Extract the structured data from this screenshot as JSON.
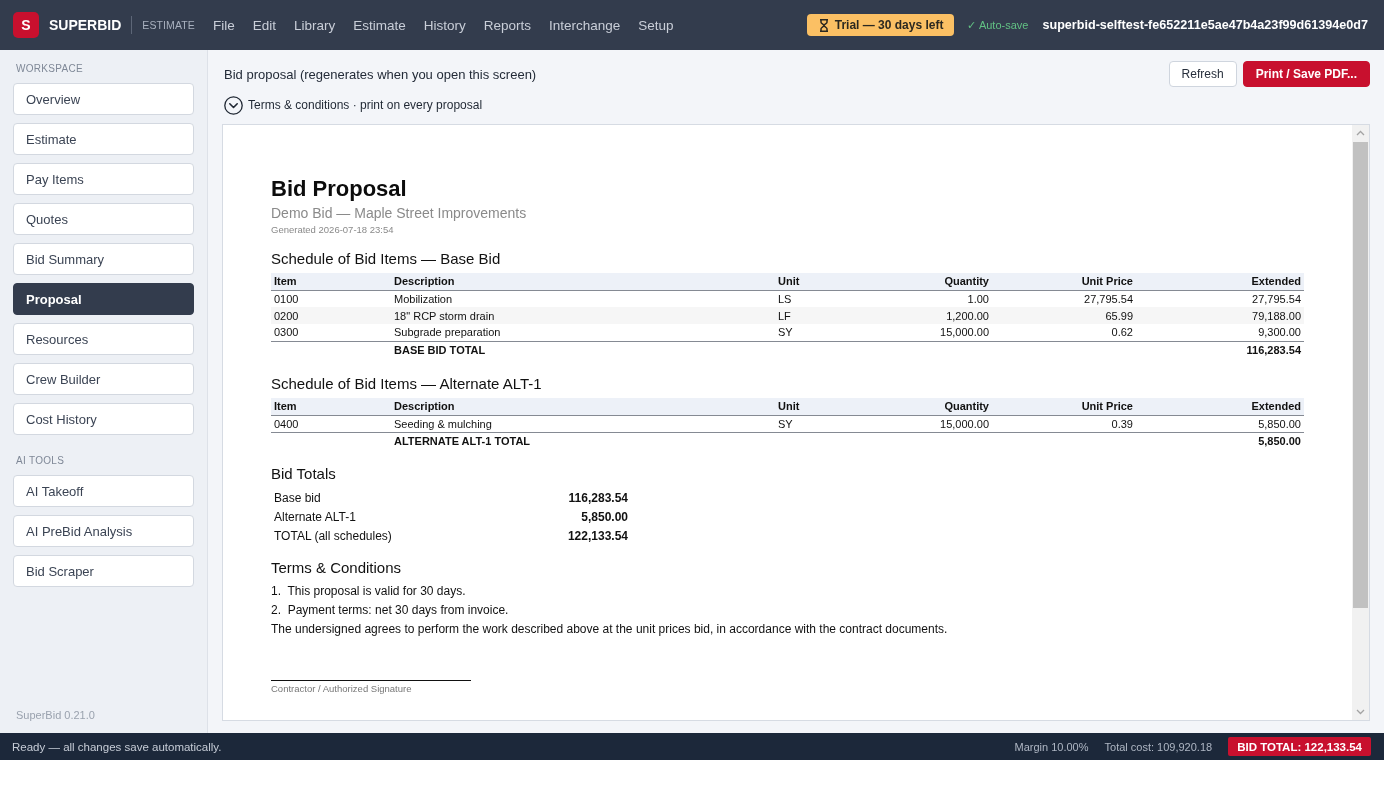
{
  "app_bar": {
    "logo_letter": "S",
    "brand": "SUPERBID",
    "module": "ESTIMATE",
    "menu": [
      "File",
      "Edit",
      "Library",
      "Estimate",
      "History",
      "Reports",
      "Interchange",
      "Setup"
    ],
    "trial_badge": "Trial — 30 days left",
    "autosave": "✓ Auto-save",
    "project": "superbid-selftest-fe652211e5ae47b4a23f99d61394e0d7"
  },
  "sidebar": {
    "sections": [
      {
        "title": "WORKSPACE",
        "items": [
          {
            "label": "Overview",
            "selected": false
          },
          {
            "label": "Estimate",
            "selected": false
          },
          {
            "label": "Pay Items",
            "selected": false
          },
          {
            "label": "Quotes",
            "selected": false
          },
          {
            "label": "Bid Summary",
            "selected": false
          },
          {
            "label": "Proposal",
            "selected": true
          },
          {
            "label": "Resources",
            "selected": false
          },
          {
            "label": "Crew Builder",
            "selected": false
          },
          {
            "label": "Cost History",
            "selected": false
          }
        ]
      },
      {
        "title": "AI TOOLS",
        "items": [
          {
            "label": "AI Takeoff",
            "selected": false
          },
          {
            "label": "AI PreBid Analysis",
            "selected": false
          },
          {
            "label": "Bid Scraper",
            "selected": false
          }
        ]
      }
    ],
    "version": "SuperBid 0.21.0"
  },
  "main": {
    "title": "Bid proposal (regenerates when you open this screen)",
    "buttons": [
      {
        "label": "Refresh",
        "kind": "secondary"
      },
      {
        "label": "Print / Save PDF...",
        "kind": "primary"
      }
    ],
    "terms_toggle": {
      "label": "Terms & conditions · print on every proposal",
      "expanded": false
    },
    "document": {
      "title": "Bid Proposal",
      "subtitle": "Demo Bid — Maple Street Improvements",
      "generated": "Generated 2026-07-18 23:54",
      "schedules": [
        {
          "heading": "Schedule of Bid Items — Base Bid",
          "columns": [
            "Item",
            "Description",
            "Unit",
            "Quantity",
            "Unit Price",
            "Extended"
          ],
          "rows": [
            [
              "0100",
              "Mobilization",
              "LS",
              "1.00",
              "27,795.54",
              "27,795.54"
            ],
            [
              "0200",
              "18\" RCP storm drain",
              "LF",
              "1,200.00",
              "65.99",
              "79,188.00"
            ],
            [
              "0300",
              "Subgrade preparation",
              "SY",
              "15,000.00",
              "0.62",
              "9,300.00"
            ]
          ],
          "total_label": "BASE BID TOTAL",
          "total": "116,283.54"
        },
        {
          "heading": "Schedule of Bid Items — Alternate ALT-1",
          "columns": [
            "Item",
            "Description",
            "Unit",
            "Quantity",
            "Unit Price",
            "Extended"
          ],
          "rows": [
            [
              "0400",
              "Seeding & mulching",
              "SY",
              "15,000.00",
              "0.39",
              "5,850.00"
            ]
          ],
          "total_label": "ALTERNATE ALT-1 TOTAL",
          "total": "5,850.00"
        }
      ],
      "totals": {
        "heading": "Bid Totals",
        "rows": [
          {
            "label": "Base bid",
            "value": "116,283.54"
          },
          {
            "label": "Alternate ALT-1",
            "value": "5,850.00"
          },
          {
            "label": "TOTAL (all schedules)",
            "value": "122,133.54"
          }
        ]
      },
      "terms": {
        "heading": "Terms & Conditions",
        "items": [
          "1.  This proposal is valid for 30 days.",
          "2.  Payment terms: net 30 days from invoice."
        ],
        "statement": "The undersigned agrees to perform the work described above at the unit prices bid, in accordance with the contract documents."
      },
      "signature": {
        "caption": "Contractor / Authorized Signature"
      }
    }
  },
  "status_bar": {
    "message": "Ready — all changes save automatically.",
    "margin": "Margin 10.00%",
    "total_cost": "Total cost: 109,920.18",
    "bid_total": "BID TOTAL: 122,133.54"
  }
}
